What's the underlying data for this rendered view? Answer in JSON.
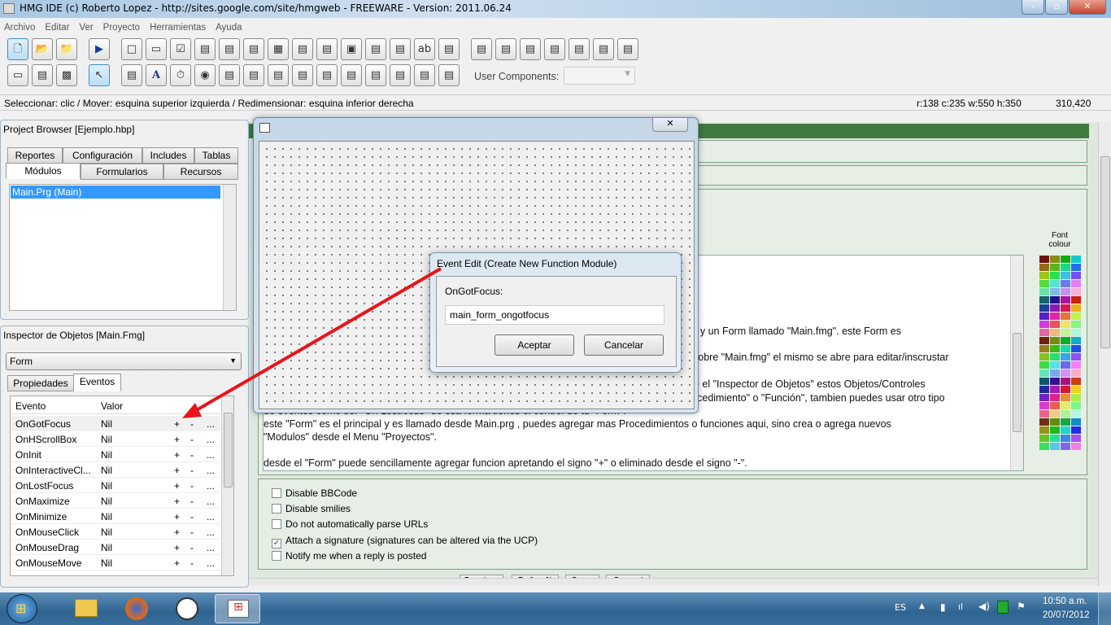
{
  "window": {
    "title": "HMG IDE (c) Roberto Lopez - http://sites.google.com/site/hmgweb - FREEWARE - Version: 2011.06.24"
  },
  "menu": [
    "Archivo",
    "Editar",
    "Ver",
    "Proyecto",
    "Herramientas",
    "Ayuda"
  ],
  "toolbar": {
    "row1": [
      "new-file",
      "open-folder",
      "open-recent",
      "run",
      "label",
      "frame",
      "checkbox",
      "listbox",
      "combobox",
      "splitter",
      "grid",
      "slider",
      "spinner",
      "image",
      "tree",
      "datepicker",
      "textbox",
      "editbox",
      "align-top",
      "align-middle",
      "align-bottom",
      "align-left",
      "align-center",
      "align-right",
      "align-columns"
    ],
    "row2": [
      "form",
      "document",
      "report",
      "pointer",
      "activex",
      "font-label",
      "timer",
      "radio",
      "richedit",
      "tab",
      "hotkey",
      "hyperlink",
      "monthcal",
      "progressbar",
      "ipaddress",
      "animate",
      "button",
      "browse"
    ],
    "user_components_label": "User Components:",
    "user_components_value": ""
  },
  "status": {
    "hint": "Seleccionar: clic / Mover: esquina superior izquierda / Redimensionar: esquina inferior derecha",
    "geometry": "r:138 c:235 w:550 h:350",
    "coords": "310,420"
  },
  "project_browser": {
    "title": "Project Browser [Ejemplo.hbp]",
    "tabs_row1": [
      "Reportes",
      "Configuración",
      "Includes",
      "Tablas"
    ],
    "tabs_row2": [
      "Módulos",
      "Formularios",
      "Recursos"
    ],
    "active_tab": "Módulos",
    "items": [
      "Main.Prg (Main)"
    ]
  },
  "inspector": {
    "title": "Inspector de Objetos [Main.Fmg]",
    "object": "Form",
    "tabs": [
      "Propiedades",
      "Eventos"
    ],
    "active_tab": "Eventos",
    "columns": [
      "Evento",
      "Valor"
    ],
    "rows": [
      {
        "event": "OnGotFocus",
        "value": "Nil"
      },
      {
        "event": "OnHScrollBox",
        "value": "Nil"
      },
      {
        "event": "OnInit",
        "value": "Nil"
      },
      {
        "event": "OnInteractiveCl...",
        "value": "Nil"
      },
      {
        "event": "OnLostFocus",
        "value": "Nil"
      },
      {
        "event": "OnMaximize",
        "value": "Nil"
      },
      {
        "event": "OnMinimize",
        "value": "Nil"
      },
      {
        "event": "OnMouseClick",
        "value": "Nil"
      },
      {
        "event": "OnMouseDrag",
        "value": "Nil"
      },
      {
        "event": "OnMouseMove",
        "value": "Nil"
      }
    ],
    "add": "+",
    "remove": "-",
    "more": "..."
  },
  "dialog": {
    "title": "Event Edit (Create New Function Module)",
    "label": "OnGotFocus:",
    "value": "main_form_ongotfocus",
    "ok": "Aceptar",
    "cancel": "Cancelar"
  },
  "background_page": {
    "font_colour_label": "Font colour",
    "text_fragments": [
      "g\" y un Form llamado \"Main.fmg\".  este Form es",
      "sobre \"Main.fmg\" el mismo se abre para editar/inscrustar",
      "de el \"Inspector de Objetos\" estos Objetos/Controles",
      "rocedimiento\" o \"Función\", tambien puedes usar otro tipo",
      "de eventos como ser \"On Lostfocus\" de esa forma tienes el control de tu \"Form\".",
      "este \"Form\" es el principal y es llamado desde Main.prg , puedes agregar mas Procedimientos o funciones aqui, sino crea o agrega nuevos",
      "\"Modulos\" desde el Menu \"Proyectos\".",
      "desde el \"Form\" puede sencillamente agregar funcion apretando el signo \"+\" o eliminado desde el signo \"-\"."
    ],
    "options": [
      {
        "label": "Disable BBCode",
        "checked": false
      },
      {
        "label": "Disable smilies",
        "checked": false
      },
      {
        "label": "Do not automatically parse URLs",
        "checked": false
      },
      {
        "label": "Attach a signature (signatures can be altered via the UCP)",
        "checked": true
      },
      {
        "label": "Notify me when a reply is posted",
        "checked": false
      }
    ],
    "buttons": [
      "Preview",
      "Submit",
      "Save",
      "Cancel"
    ]
  },
  "taskbar": {
    "language": "ES",
    "time": "10:50 a.m.",
    "date": "20/07/2012"
  },
  "colors": {
    "annotation_arrow": "#e8141a",
    "forum_header": "#3f7a3f"
  }
}
